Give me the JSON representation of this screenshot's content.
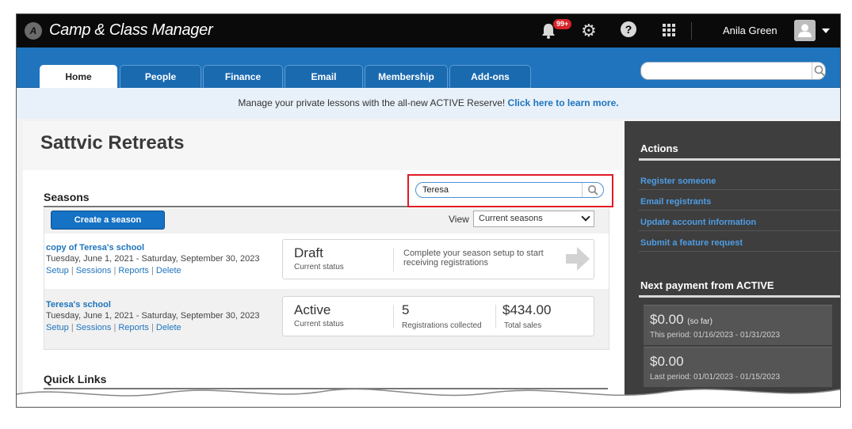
{
  "app": {
    "title": "Camp & Class Manager",
    "notification_badge": "99+",
    "user_name": "Anila Green"
  },
  "nav": {
    "tabs": [
      {
        "label": "Home",
        "active": true
      },
      {
        "label": "People",
        "active": false
      },
      {
        "label": "Finance",
        "active": false
      },
      {
        "label": "Email",
        "active": false
      },
      {
        "label": "Membership",
        "active": false
      },
      {
        "label": "Add-ons",
        "active": false
      }
    ],
    "search_value": ""
  },
  "announcement": {
    "text": "Manage your private lessons with the all-new ACTIVE Reserve!",
    "link": "Click here to learn more."
  },
  "main": {
    "org_title": "Sattvic Retreats",
    "seasons": {
      "title": "Seasons",
      "search_value": "Teresa",
      "create_label": "Create a season",
      "view_label": "View",
      "view_selected": "Current seasons",
      "items": [
        {
          "name": "copy of Teresa's school",
          "dates": "Tuesday, June 1, 2021 - Saturday, September 30, 2023",
          "links": [
            "Setup",
            "Sessions",
            "Reports",
            "Delete"
          ],
          "status": "Draft",
          "status_caption": "Current status",
          "message": "Complete your season setup to start receiving registrations"
        },
        {
          "name": "Teresa's school",
          "dates": "Tuesday, June 1, 2021 - Saturday, September 30, 2023",
          "links": [
            "Setup",
            "Sessions",
            "Reports",
            "Delete"
          ],
          "status": "Active",
          "status_caption": "Current status",
          "registrations": "5",
          "registrations_caption": "Registrations collected",
          "sales": "$434.00",
          "sales_caption": "Total sales"
        }
      ]
    },
    "quick_links_title": "Quick Links"
  },
  "sidebar": {
    "actions_title": "Actions",
    "actions": [
      "Register someone",
      "Email registrants",
      "Update account information",
      "Submit a feature request"
    ],
    "payment_title": "Next payment from ACTIVE",
    "payments": [
      {
        "amount": "$0.00",
        "note": "(so far)",
        "period": "This period: 01/16/2023 - 01/31/2023"
      },
      {
        "amount": "$0.00",
        "note": "",
        "period": "Last period: 01/01/2023 - 01/15/2023"
      }
    ]
  },
  "colors": {
    "nav_blue": "#1f74bd",
    "highlight_red": "#e01b24",
    "sidebar_dark": "#3e3e3e",
    "link_blue": "#4f9de4"
  }
}
